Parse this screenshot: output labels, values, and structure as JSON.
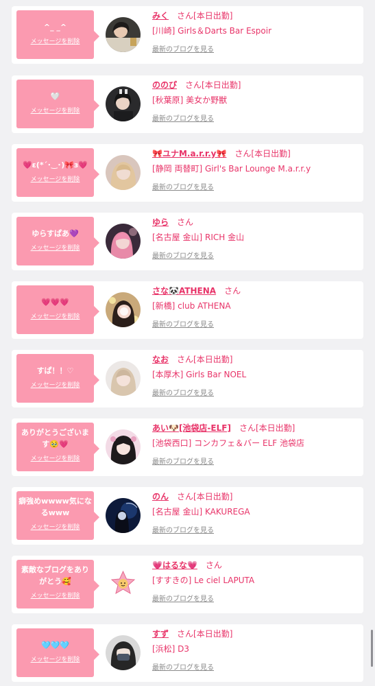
{
  "labels": {
    "delete": "メッセージを削除",
    "blog": "最新のブログを見る",
    "san": "さん"
  },
  "colors": {
    "bubble": "#fb9ab0",
    "accent": "#e83368",
    "link_gray": "#8a8a8a",
    "background": "#f1f1f3"
  },
  "messages": [
    {
      "text": "^_ _^",
      "name": "みく",
      "status": "[本日出勤]",
      "shop": "[川崎] Girls＆Darts Bar Espoir",
      "avatar": "photo"
    },
    {
      "text": "🤍",
      "name": "ののぴ",
      "status": "[本日出勤]",
      "shop": "[秋葉原] 美女か野獣",
      "avatar": "photo"
    },
    {
      "text": "💗ε(*´･‿･)🎀з💗",
      "name": "🎀ユナM.a.r.r.y🎀",
      "status": "[本日出勤]",
      "shop": "[静岡 両替町] Girl's Bar Lounge M.a.r.r.y",
      "avatar": "photo"
    },
    {
      "text": "ゆらすぱあ💜",
      "name": "ゆら",
      "status": "",
      "shop": "[名古屋 金山] RICH 金山",
      "avatar": "photo"
    },
    {
      "text": "💗💗💗",
      "name": "さな🐼ATHENA",
      "status": "",
      "shop": "[新橋] club ATHENA",
      "avatar": "photo"
    },
    {
      "text": "すぱ！！♡",
      "name": "なお",
      "status": "[本日出勤]",
      "shop": "[本厚木] Girls Bar NOEL",
      "avatar": "photo"
    },
    {
      "text": "ありがとうございます🥹💗",
      "name": "あい🐶[池袋店-ELF]",
      "status": "[本日出勤]",
      "shop": "[池袋西口] コンカフェ＆バー ELF 池袋店",
      "avatar": "photo"
    },
    {
      "text": "癖強めwwww気になるwww",
      "name": "のん",
      "status": "[本日出勤]",
      "shop": "[名古屋 金山] KAKUREGA",
      "avatar": "photo"
    },
    {
      "text": "素敵なブログをありがとう🥰",
      "name": "💗はるな💗",
      "status": "",
      "shop": "[すすきの] Le ciel LAPUTA",
      "avatar": "photo"
    },
    {
      "text": "🩵🩵🩵",
      "name": "すず",
      "status": "[本日出勤]",
      "shop": "[浜松] D3",
      "avatar": "photo"
    }
  ]
}
